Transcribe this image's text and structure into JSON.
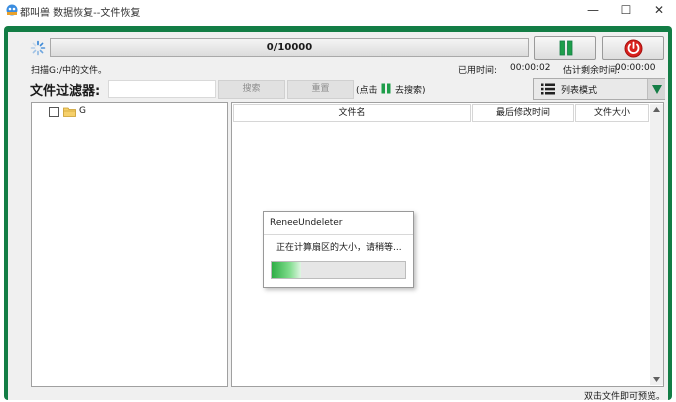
{
  "window": {
    "title": "都叫兽 数据恢复--文件恢复",
    "minimize_glyph": "—",
    "maximize_glyph": "☐",
    "close_glyph": "✕"
  },
  "scan": {
    "progress_text": "0/10000",
    "status_text": "扫描G:/中的文件。",
    "elapsed_label": "已用时间:",
    "elapsed_value": "00:00:02",
    "remaining_label": "估计剩余时间:",
    "remaining_value": "00:00:00"
  },
  "filter": {
    "label": "文件过滤器:",
    "input_value": "",
    "search_label": "搜索",
    "reset_label": "重置",
    "hint_before": "(点击",
    "hint_after": "去搜索)"
  },
  "view_mode": {
    "label": "列表模式"
  },
  "tree": {
    "items": [
      {
        "label": "G",
        "checked": false
      }
    ]
  },
  "list": {
    "columns": [
      "文件名",
      "最后修改时间",
      "文件大小"
    ]
  },
  "footer": {
    "hint": "双击文件即可预览。"
  },
  "dialog": {
    "title": "ReneeUndeleter",
    "message": "正在计算扇区的大小，请稍等...",
    "progress_fraction": 0.22
  },
  "colors": {
    "frame_green": "#137d45",
    "pause_green": "#1e9e4a",
    "stop_red": "#d8201d"
  },
  "icons": {
    "app": "app-logo-icon",
    "spinner": "loading-spinner-icon",
    "pause": "pause-icon",
    "stop": "stop-icon",
    "list": "list-view-icon",
    "dropdown": "triangle-down-icon",
    "folder": "folder-icon"
  }
}
